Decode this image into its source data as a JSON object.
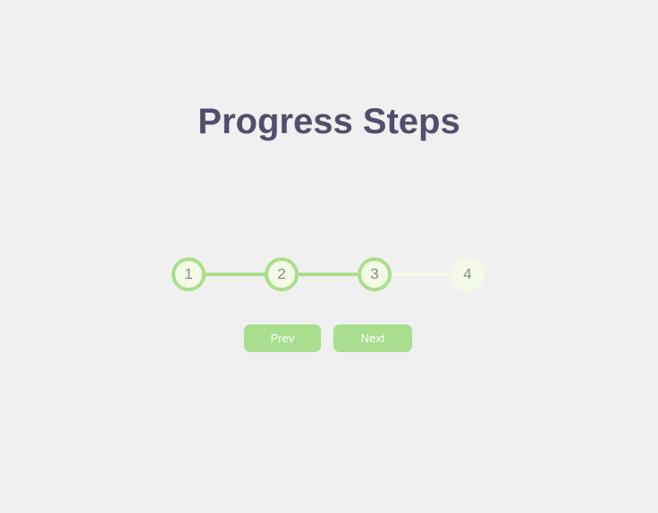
{
  "title": "Progress Steps",
  "progress": {
    "steps": [
      "1",
      "2",
      "3",
      "4"
    ],
    "active_count": 3,
    "total_steps": 4,
    "fill_fraction": 0.667
  },
  "buttons": {
    "prev_label": "Prev",
    "next_label": "Next"
  },
  "colors": {
    "accent": "#a9df8c",
    "inactive": "#f3fbe6",
    "title": "#544d6e",
    "background": "#f0f0f0"
  }
}
